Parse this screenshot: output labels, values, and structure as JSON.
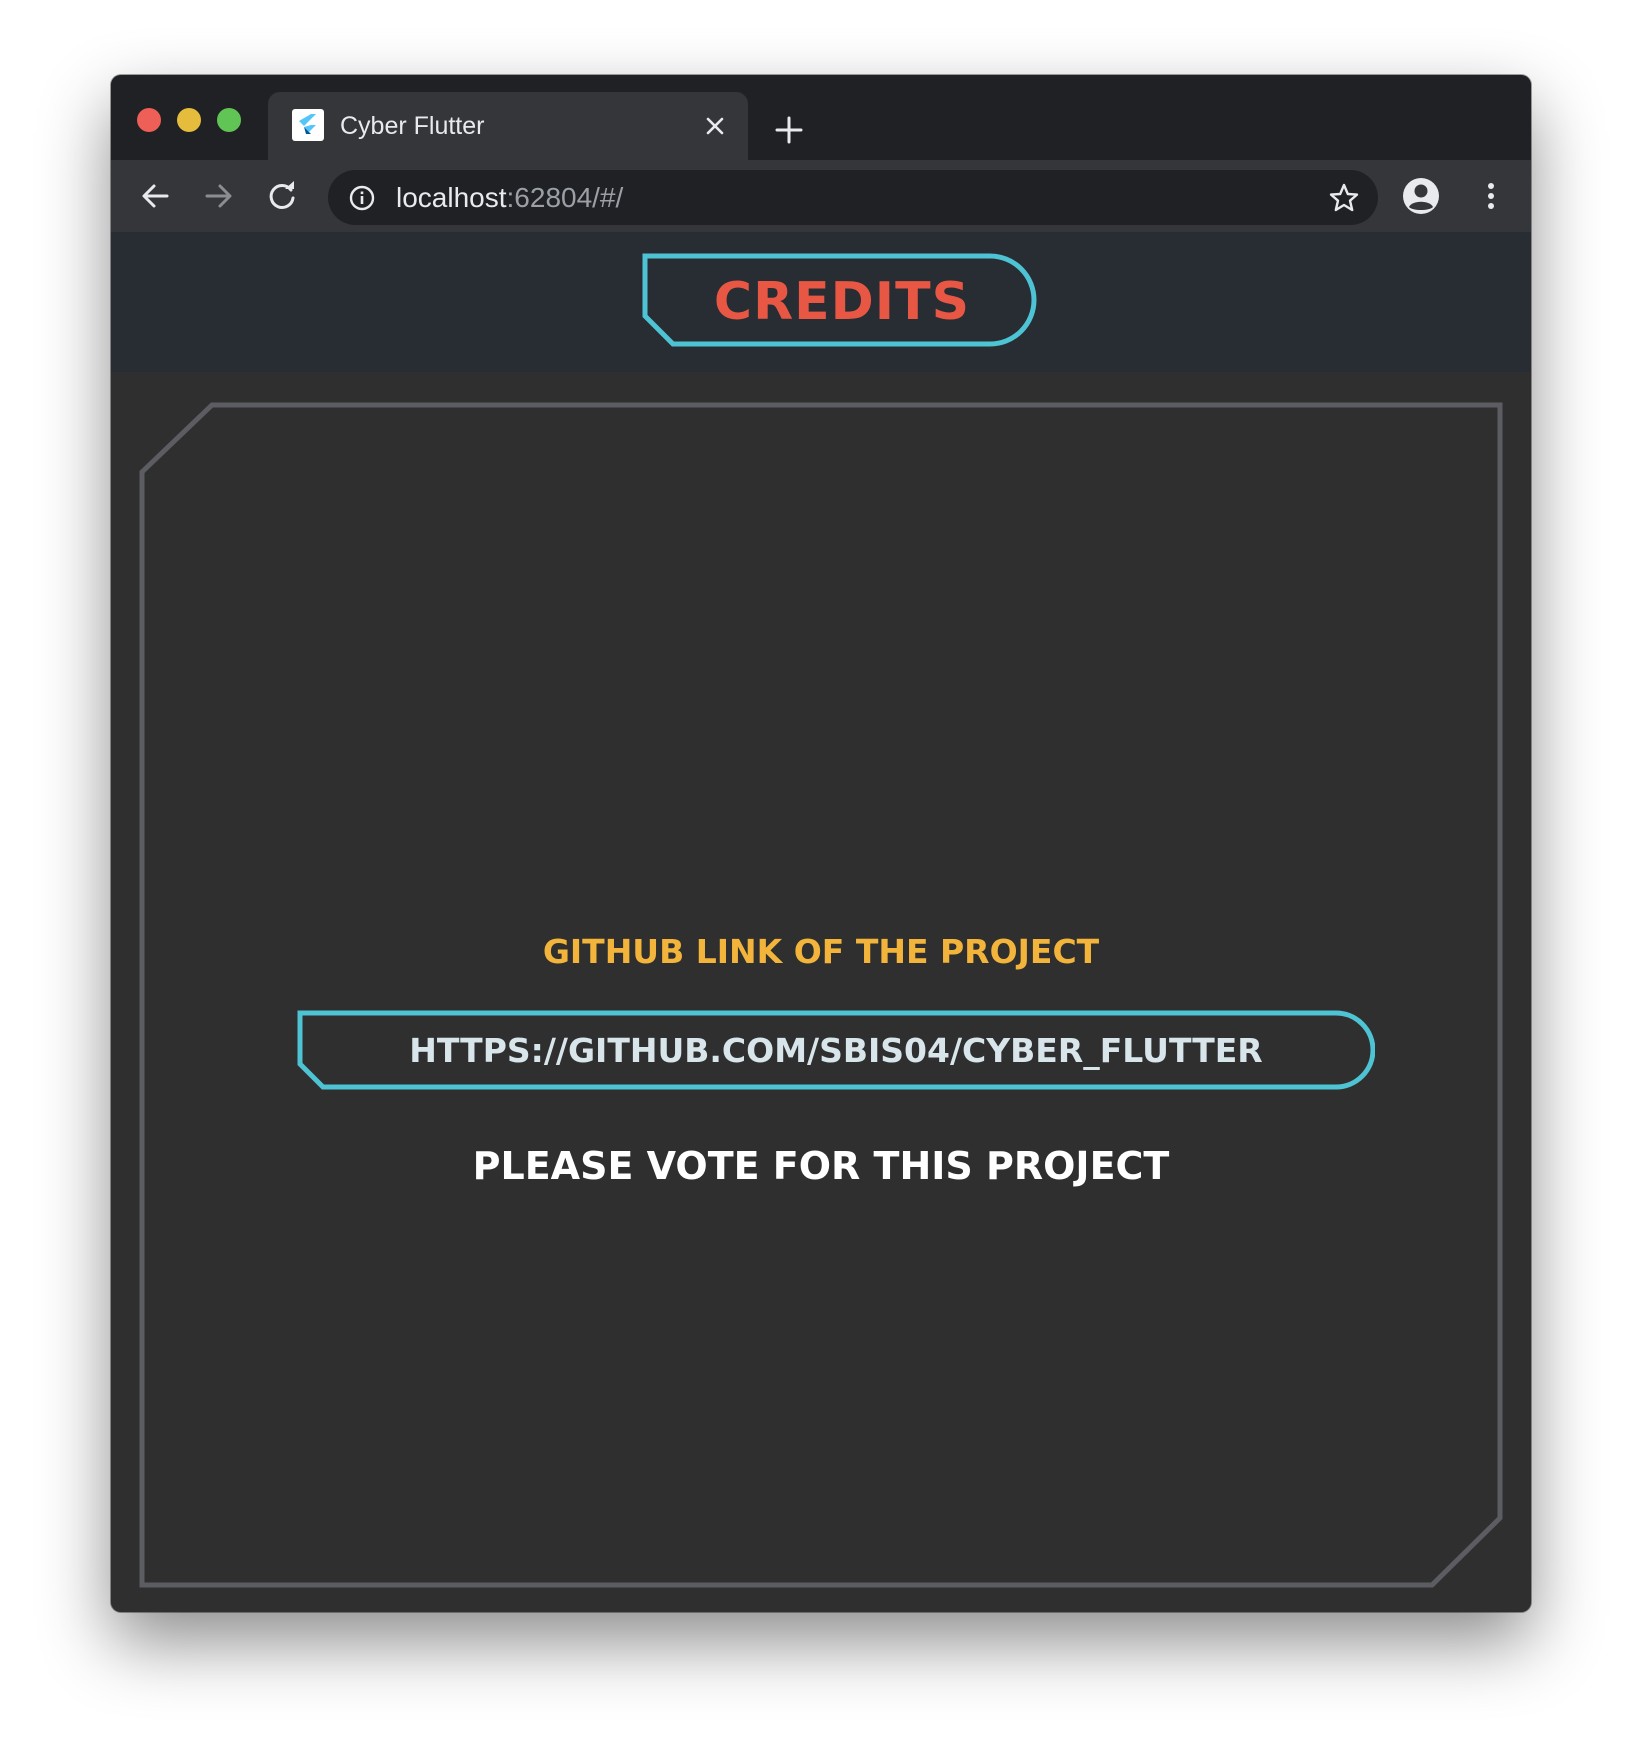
{
  "browser": {
    "tab_title": "Cyber Flutter",
    "url_host": "localhost",
    "url_rest": ":62804/#/",
    "icons": {
      "favicon": "flutter-logo-icon",
      "close": "close-icon",
      "new_tab": "plus-icon",
      "back": "arrow-left-icon",
      "forward": "arrow-right-icon",
      "reload": "reload-icon",
      "info": "info-icon",
      "bookmark": "star-icon",
      "profile": "account-circle-icon",
      "menu": "more-vert-icon"
    }
  },
  "appbar": {
    "title": "CREDITS"
  },
  "main": {
    "github_label": "GITHUB LINK OF THE PROJECT",
    "github_link": "HTTPS://GITHUB.COM/SBIS04/CYBER_FLUTTER",
    "vote_text": "PLEASE VOTE FOR THIS PROJECT"
  },
  "colors": {
    "accent_cyan": "#4ec3d4",
    "title_red": "#e85744",
    "label_yellow": "#f3b43b",
    "frame_gray": "#5b5d62",
    "page_bg": "#2f2f2f",
    "appbar_bg": "#282c33"
  }
}
